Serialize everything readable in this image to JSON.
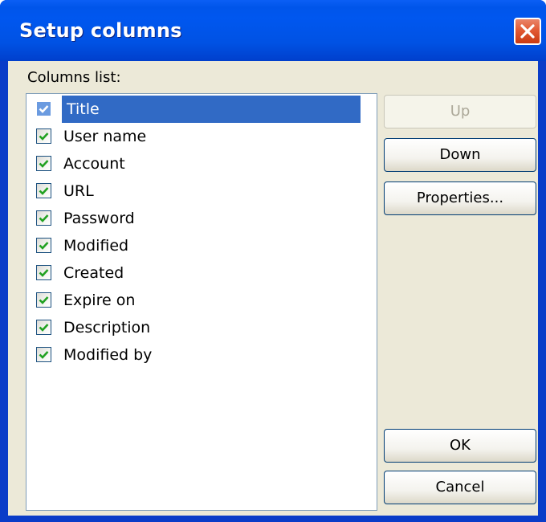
{
  "window": {
    "title": "Setup columns"
  },
  "columns_list": {
    "label": "Columns list:",
    "items": [
      {
        "label": "Title",
        "checked": true,
        "selected": true
      },
      {
        "label": "User name",
        "checked": true,
        "selected": false
      },
      {
        "label": "Account",
        "checked": true,
        "selected": false
      },
      {
        "label": "URL",
        "checked": true,
        "selected": false
      },
      {
        "label": "Password",
        "checked": true,
        "selected": false
      },
      {
        "label": "Modified",
        "checked": true,
        "selected": false
      },
      {
        "label": "Created",
        "checked": true,
        "selected": false
      },
      {
        "label": "Expire on",
        "checked": true,
        "selected": false
      },
      {
        "label": "Description",
        "checked": true,
        "selected": false
      },
      {
        "label": "Modified by",
        "checked": true,
        "selected": false
      }
    ]
  },
  "buttons": {
    "up": {
      "label": "Up",
      "enabled": false
    },
    "down": {
      "label": "Down",
      "enabled": true
    },
    "properties": {
      "label": "Properties...",
      "enabled": true
    },
    "ok": {
      "label": "OK",
      "enabled": true
    },
    "cancel": {
      "label": "Cancel",
      "enabled": true
    }
  },
  "colors": {
    "titlebar": "#0055ea",
    "selection": "#316ac5",
    "checkmark": "#21a121",
    "dialog_face": "#ece9d8"
  }
}
